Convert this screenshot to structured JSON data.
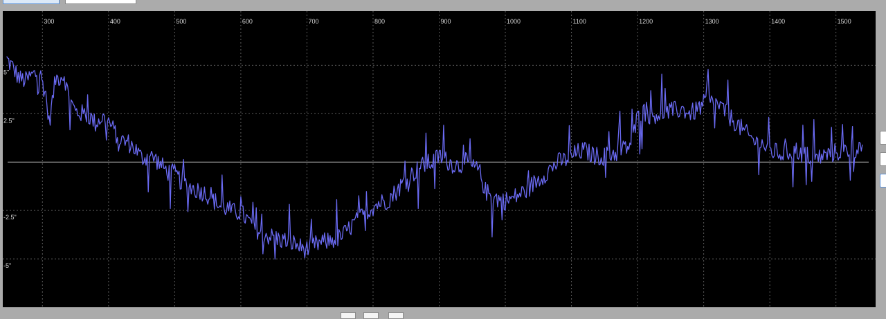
{
  "colors": {
    "background": "#000000",
    "frame": "#ababab",
    "line": "#6a6af2",
    "grid": "#5c5c5c",
    "zero_line": "#b4b4b4",
    "label": "#d8d8d8"
  },
  "chart_data": {
    "type": "line",
    "title": "",
    "xlabel": "",
    "ylabel": "",
    "xlim": [
      240,
      1560
    ],
    "ylim": [
      -7.5,
      7.8
    ],
    "grid": true,
    "zero_line": true,
    "x_ticks": [
      300,
      400,
      500,
      600,
      700,
      800,
      900,
      1000,
      1100,
      1200,
      1300,
      1400,
      1500
    ],
    "x_tick_labels": [
      "300",
      "400",
      "500",
      "600",
      "700",
      "800",
      "900",
      "1000",
      "1100",
      "1200",
      "1300",
      "1400",
      "1500"
    ],
    "y_ticks": [
      5,
      2.5,
      -2.5,
      -5
    ],
    "y_tick_labels": [
      "5\"",
      "2.5\"",
      "-2.5\"",
      "-5\""
    ],
    "noise_amplitude": 0.9,
    "series": [
      {
        "name": "",
        "x": [
          246,
          255,
          265,
          275,
          285,
          296,
          305,
          310,
          320,
          333,
          340,
          350,
          360,
          370,
          380,
          390,
          400,
          410,
          420,
          430,
          440,
          450,
          460,
          470,
          480,
          490,
          500,
          510,
          520,
          530,
          540,
          550,
          560,
          570,
          580,
          590,
          600,
          610,
          620,
          630,
          640,
          650,
          660,
          670,
          680,
          690,
          700,
          710,
          720,
          730,
          740,
          750,
          760,
          770,
          780,
          790,
          800,
          810,
          820,
          830,
          840,
          850,
          860,
          870,
          880,
          890,
          900,
          910,
          920,
          930,
          940,
          950,
          960,
          970,
          980,
          990,
          1000,
          1010,
          1020,
          1030,
          1040,
          1050,
          1060,
          1070,
          1080,
          1090,
          1100,
          1110,
          1120,
          1130,
          1140,
          1150,
          1160,
          1170,
          1180,
          1190,
          1200,
          1210,
          1220,
          1230,
          1240,
          1250,
          1260,
          1270,
          1280,
          1290,
          1300,
          1310,
          1320,
          1330,
          1340,
          1350,
          1360,
          1370,
          1380,
          1390,
          1400,
          1410,
          1420,
          1430,
          1440,
          1450,
          1460,
          1470,
          1480,
          1490,
          1500,
          1510,
          1520,
          1530,
          1540
        ],
        "values": [
          5.3,
          4.9,
          4.3,
          4.2,
          4.5,
          4.6,
          3.5,
          2.0,
          4.3,
          4.5,
          3.3,
          2.6,
          2.5,
          2.4,
          2.0,
          2.3,
          2.1,
          1.5,
          1.1,
          1.0,
          0.7,
          0.2,
          0.3,
          0.2,
          -0.2,
          -0.5,
          -0.6,
          -1.0,
          -1.2,
          -1.4,
          -1.5,
          -1.7,
          -2.0,
          -2.3,
          -2.4,
          -2.6,
          -2.6,
          -3.0,
          -3.4,
          -3.6,
          -3.8,
          -3.9,
          -4.0,
          -4.1,
          -4.2,
          -4.4,
          -4.5,
          -4.3,
          -4.2,
          -4.1,
          -4.0,
          -3.9,
          -3.6,
          -3.2,
          -2.9,
          -2.6,
          -2.3,
          -2.1,
          -2.0,
          -1.7,
          -1.3,
          -0.9,
          -0.6,
          -0.3,
          -0.1,
          0.0,
          0.3,
          0.1,
          -0.1,
          -0.2,
          0.0,
          -0.3,
          -0.4,
          -1.5,
          -1.8,
          -1.9,
          -2.0,
          -1.9,
          -1.7,
          -1.5,
          -1.2,
          -0.9,
          -0.6,
          -0.3,
          0.0,
          0.1,
          0.3,
          0.5,
          0.6,
          0.4,
          0.3,
          0.3,
          0.4,
          0.5,
          0.7,
          0.9,
          2.3,
          2.6,
          2.4,
          2.5,
          2.5,
          2.6,
          2.7,
          2.7,
          2.5,
          2.7,
          3.0,
          3.1,
          3.0,
          2.7,
          2.3,
          2.0,
          1.6,
          1.3,
          1.0,
          0.9,
          0.6,
          0.5,
          0.4,
          0.5,
          0.6,
          0.4,
          0.3,
          0.2,
          0.3,
          0.4,
          0.5,
          0.6,
          0.6,
          0.7,
          0.9
        ]
      }
    ]
  }
}
